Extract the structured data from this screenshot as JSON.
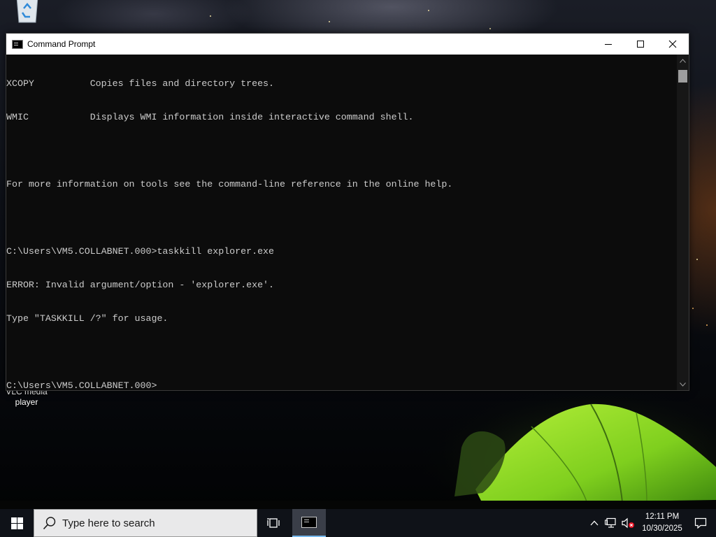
{
  "desktop": {
    "icons": [
      {
        "label": "Recycle Bin"
      },
      {
        "label": "VLC media player"
      }
    ]
  },
  "window": {
    "title": "Command Prompt",
    "controls": {
      "minimize": "—",
      "maximize": "☐",
      "close": "✕"
    },
    "console_lines": [
      "XCOPY          Copies files and directory trees.",
      "WMIC           Displays WMI information inside interactive command shell.",
      "",
      "For more information on tools see the command-line reference in the online help.",
      "",
      "C:\\Users\\VM5.COLLABNET.000>taskkill explorer.exe",
      "ERROR: Invalid argument/option - 'explorer.exe'.",
      "Type \"TASKKILL /?\" for usage.",
      "",
      "C:\\Users\\VM5.COLLABNET.000>"
    ]
  },
  "taskbar": {
    "search_placeholder": "Type here to search",
    "pinned": [
      {
        "icon": "command-prompt-icon",
        "active": true
      }
    ],
    "tray": {
      "time": "12:11 PM",
      "date": "10/30/2025"
    }
  },
  "colors": {
    "console_bg": "#0c0c0c",
    "console_text": "#cccccc",
    "taskbar_bg": "#0f1218",
    "active_app_underline": "#76b9ed"
  }
}
